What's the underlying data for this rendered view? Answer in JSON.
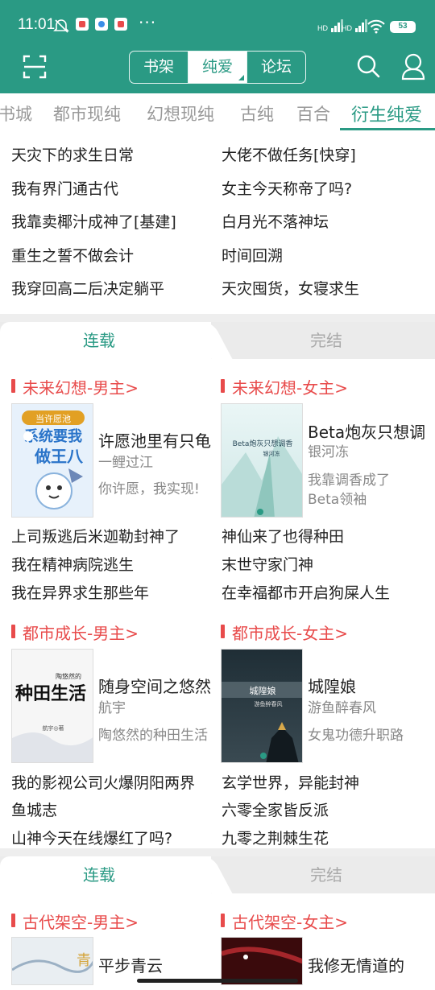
{
  "status": {
    "time": "11:01",
    "battery": "53",
    "dots": "···",
    "hd1": "HD",
    "hd2": "HD"
  },
  "header": {
    "segments": [
      "书架",
      "纯爱",
      "论坛"
    ],
    "active_segment": "纯爱",
    "accent": "#2a9a84"
  },
  "categories": [
    "书城",
    "都市现纯",
    "幻想现纯",
    "古纯",
    "百合",
    "衍生纯爱"
  ],
  "active_category": "衍生纯爱",
  "top_list": {
    "left": [
      "天灾下的求生日常",
      "我有界门通古代",
      "我靠卖椰汁成神了[基建]",
      "重生之誓不做会计",
      "我穿回高二后决定躺平"
    ],
    "right": [
      "大佬不做任务[快穿]",
      "女主今天称帝了吗?",
      "白月光不落神坛",
      "时间回溯",
      "天灾囤货，女寝求生"
    ]
  },
  "block1": {
    "tabs": [
      "连载",
      "完结"
    ],
    "sections": [
      {
        "title": "未来幻想-男主>",
        "book": {
          "title": "许愿池里有只龟",
          "author": "一鲤过江",
          "desc": "你许愿，我实现!",
          "cover_text": "系统要我做王八",
          "cover_badge": "当许愿池"
        },
        "list": [
          "上司叛逃后米迦勒封神了",
          "我在精神病院逃生",
          "我在异界求生那些年"
        ]
      },
      {
        "title": "未来幻想-女主>",
        "book": {
          "title": "Beta炮灰只想调",
          "author": "银河冻",
          "desc": "我靠调香成了Beta领袖",
          "desc_lines": [
            "我靠调香成了",
            "Beta领袖"
          ],
          "cover_text": "Beta炮灰只想调香",
          "cover_sub": "银河冻"
        },
        "list": [
          "神仙来了也得种田",
          "末世守家门神",
          "在幸福都市开启狗屎人生"
        ]
      },
      {
        "title": "都市成长-男主>",
        "book": {
          "title": "随身空间之悠然",
          "author": "航宇",
          "desc": "陶悠然的种田生活",
          "cover_text": "种田生活",
          "cover_sub": "陶悠然的",
          "cover_author": "航宇◎著"
        },
        "list": [
          "我的影视公司火爆阴阳两界",
          "鱼城志",
          "山神今天在线爆红了吗?"
        ]
      },
      {
        "title": "都市成长-女主>",
        "book": {
          "title": "城隍娘",
          "author": "游鱼醉春风",
          "desc": "女鬼功德升职路",
          "cover_text": "城隍娘",
          "cover_sub": "游鱼醉春风"
        },
        "list": [
          "玄学世界，异能封神",
          "六零全家皆反派",
          "九零之荆棘生花"
        ]
      }
    ]
  },
  "block2": {
    "tabs": [
      "连载",
      "完结"
    ],
    "sections": [
      {
        "title": "古代架空-男主>",
        "book": {
          "title": "平步青云"
        }
      },
      {
        "title": "古代架空-女主>",
        "book": {
          "title": "我修无情道的"
        }
      }
    ]
  }
}
